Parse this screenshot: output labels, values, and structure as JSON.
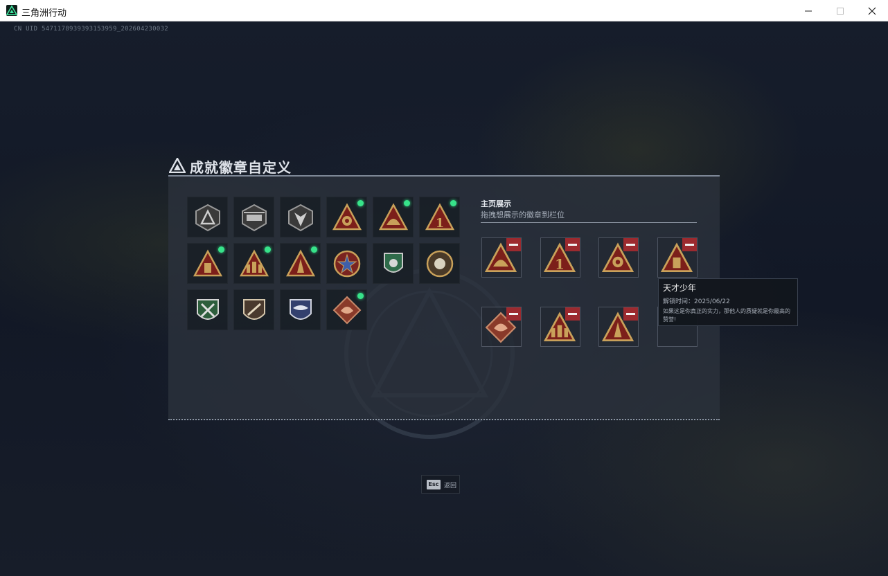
{
  "window": {
    "title": "三角洲行动"
  },
  "uid": "CN UID 5471178939393153959_202604230032",
  "panel": {
    "title": "成就徽章自定义"
  },
  "badges": [
    {
      "icon": "delta-triangle-badge-icon",
      "new": false
    },
    {
      "icon": "helicopter-badge-icon",
      "new": false
    },
    {
      "icon": "arrow-shield-badge-icon",
      "new": false
    },
    {
      "icon": "gear-triangle-badge-icon",
      "new": true
    },
    {
      "icon": "helmet-triangle-badge-icon",
      "new": true
    },
    {
      "icon": "number-one-triangle-badge-icon",
      "new": true
    },
    {
      "icon": "pillar-triangle-badge-icon",
      "new": true
    },
    {
      "icon": "soldiers-triangle-badge-icon",
      "new": true
    },
    {
      "icon": "tower-triangle-badge-icon",
      "new": true
    },
    {
      "icon": "star-medal-badge-icon",
      "new": false
    },
    {
      "icon": "green-shield-badge-icon",
      "new": false
    },
    {
      "icon": "flower-medal-badge-icon",
      "new": false
    },
    {
      "icon": "green-crossed-guns-badge-icon",
      "new": false
    },
    {
      "icon": "rifle-shield-badge-icon",
      "new": false
    },
    {
      "icon": "blue-eagle-badge-icon",
      "new": false
    },
    {
      "icon": "dragon-badge-icon",
      "new": true
    }
  ],
  "showcase": {
    "title": "主页展示",
    "subtitle": "拖拽想展示的徽章到栏位",
    "slots": [
      {
        "icon": "helmet-triangle-badge-icon",
        "filled": true
      },
      {
        "icon": "number-one-triangle-badge-icon",
        "filled": true
      },
      {
        "icon": "gear-triangle-badge-icon",
        "filled": true
      },
      {
        "icon": "pillar-triangle-badge-icon",
        "filled": true
      },
      {
        "icon": "dragon-badge-icon",
        "filled": true
      },
      {
        "icon": "soldiers-triangle-badge-icon",
        "filled": true
      },
      {
        "icon": "tower-triangle-badge-icon",
        "filled": true
      },
      {
        "icon": "",
        "filled": false
      }
    ]
  },
  "tooltip": {
    "name": "天才少年",
    "time_label": "解锁时间：",
    "time_value": "2025/06/22",
    "description": "如果这是你真正的实力，那他人的质疑就是你最高的赞誉!"
  },
  "footer": {
    "esc_key": "Esc",
    "esc_label": "返回"
  },
  "colors": {
    "new_dot": "#37e38a",
    "remove_button": "#9c2a2f",
    "badge_gold": "#c9a15a",
    "badge_red": "#7c1f1a"
  }
}
